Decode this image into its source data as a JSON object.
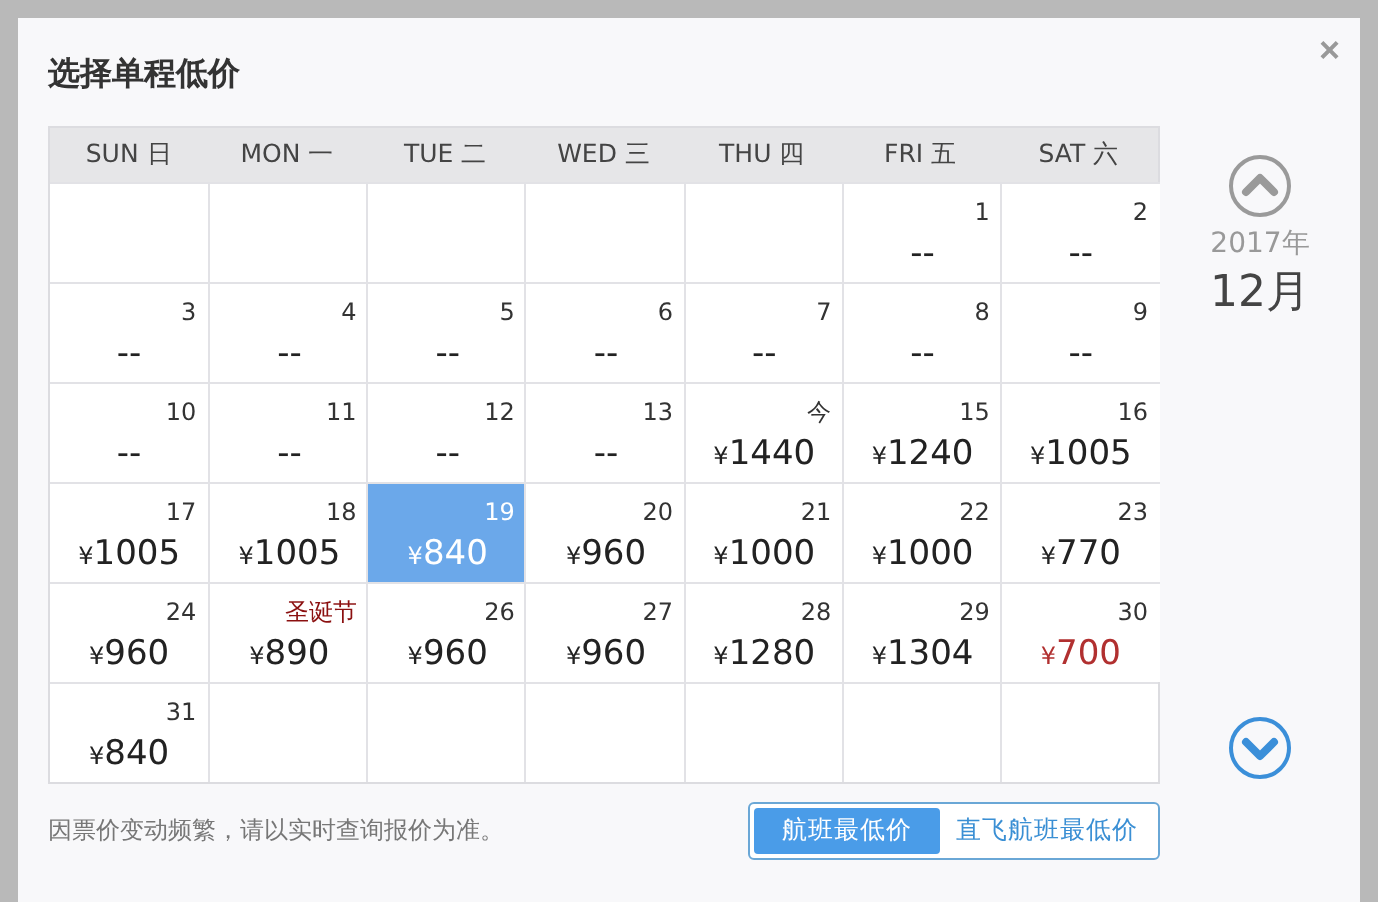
{
  "dialog": {
    "title": "选择单程低价",
    "close": "×"
  },
  "weekdays": [
    "SUN 日",
    "MON 一",
    "TUE 二",
    "WED 三",
    "THU 四",
    "FRI 五",
    "SAT 六"
  ],
  "weeks": [
    [
      {
        "kind": "blank"
      },
      {
        "kind": "blank"
      },
      {
        "kind": "blank"
      },
      {
        "kind": "blank"
      },
      {
        "kind": "blank"
      },
      {
        "kind": "day",
        "day": "1",
        "price": "--",
        "holiday": false,
        "selected": false,
        "lowest": false
      },
      {
        "kind": "day",
        "day": "2",
        "price": "--",
        "holiday": false,
        "selected": false,
        "lowest": false
      }
    ],
    [
      {
        "kind": "day",
        "day": "3",
        "price": "--",
        "holiday": false,
        "selected": false,
        "lowest": false
      },
      {
        "kind": "day",
        "day": "4",
        "price": "--",
        "holiday": false,
        "selected": false,
        "lowest": false
      },
      {
        "kind": "day",
        "day": "5",
        "price": "--",
        "holiday": false,
        "selected": false,
        "lowest": false
      },
      {
        "kind": "day",
        "day": "6",
        "price": "--",
        "holiday": false,
        "selected": false,
        "lowest": false
      },
      {
        "kind": "day",
        "day": "7",
        "price": "--",
        "holiday": false,
        "selected": false,
        "lowest": false
      },
      {
        "kind": "day",
        "day": "8",
        "price": "--",
        "holiday": false,
        "selected": false,
        "lowest": false
      },
      {
        "kind": "day",
        "day": "9",
        "price": "--",
        "holiday": false,
        "selected": false,
        "lowest": false
      }
    ],
    [
      {
        "kind": "day",
        "day": "10",
        "price": "--",
        "holiday": false,
        "selected": false,
        "lowest": false
      },
      {
        "kind": "day",
        "day": "11",
        "price": "--",
        "holiday": false,
        "selected": false,
        "lowest": false
      },
      {
        "kind": "day",
        "day": "12",
        "price": "--",
        "holiday": false,
        "selected": false,
        "lowest": false
      },
      {
        "kind": "day",
        "day": "13",
        "price": "--",
        "holiday": false,
        "selected": false,
        "lowest": false
      },
      {
        "kind": "day",
        "day": "今",
        "currency": "¥",
        "price": "1440",
        "holiday": false,
        "selected": false,
        "lowest": false
      },
      {
        "kind": "day",
        "day": "15",
        "currency": "¥",
        "price": "1240",
        "holiday": false,
        "selected": false,
        "lowest": false
      },
      {
        "kind": "day",
        "day": "16",
        "currency": "¥",
        "price": "1005",
        "holiday": false,
        "selected": false,
        "lowest": false
      }
    ],
    [
      {
        "kind": "day",
        "day": "17",
        "currency": "¥",
        "price": "1005",
        "holiday": false,
        "selected": false,
        "lowest": false
      },
      {
        "kind": "day",
        "day": "18",
        "currency": "¥",
        "price": "1005",
        "holiday": false,
        "selected": false,
        "lowest": false
      },
      {
        "kind": "day",
        "day": "19",
        "currency": "¥",
        "price": "840",
        "holiday": false,
        "selected": true,
        "lowest": false
      },
      {
        "kind": "day",
        "day": "20",
        "currency": "¥",
        "price": "960",
        "holiday": false,
        "selected": false,
        "lowest": false
      },
      {
        "kind": "day",
        "day": "21",
        "currency": "¥",
        "price": "1000",
        "holiday": false,
        "selected": false,
        "lowest": false
      },
      {
        "kind": "day",
        "day": "22",
        "currency": "¥",
        "price": "1000",
        "holiday": false,
        "selected": false,
        "lowest": false
      },
      {
        "kind": "day",
        "day": "23",
        "currency": "¥",
        "price": "770",
        "holiday": false,
        "selected": false,
        "lowest": false
      }
    ],
    [
      {
        "kind": "day",
        "day": "24",
        "currency": "¥",
        "price": "960",
        "holiday": false,
        "selected": false,
        "lowest": false
      },
      {
        "kind": "day",
        "day": "圣诞节",
        "currency": "¥",
        "price": "890",
        "holiday": true,
        "selected": false,
        "lowest": false
      },
      {
        "kind": "day",
        "day": "26",
        "currency": "¥",
        "price": "960",
        "holiday": false,
        "selected": false,
        "lowest": false
      },
      {
        "kind": "day",
        "day": "27",
        "currency": "¥",
        "price": "960",
        "holiday": false,
        "selected": false,
        "lowest": false
      },
      {
        "kind": "day",
        "day": "28",
        "currency": "¥",
        "price": "1280",
        "holiday": false,
        "selected": false,
        "lowest": false
      },
      {
        "kind": "day",
        "day": "29",
        "currency": "¥",
        "price": "1304",
        "holiday": false,
        "selected": false,
        "lowest": false
      },
      {
        "kind": "day",
        "day": "30",
        "currency": "¥",
        "price": "700",
        "holiday": false,
        "selected": false,
        "lowest": true
      }
    ],
    [
      {
        "kind": "day",
        "day": "31",
        "currency": "¥",
        "price": "840",
        "holiday": false,
        "selected": false,
        "lowest": false
      },
      {
        "kind": "blank"
      },
      {
        "kind": "blank"
      },
      {
        "kind": "blank"
      },
      {
        "kind": "blank"
      },
      {
        "kind": "blank"
      },
      {
        "kind": "blank"
      }
    ]
  ],
  "month_nav": {
    "prev": {
      "disabled": true
    },
    "year": "2017年",
    "month": "12月",
    "next": {
      "disabled": false
    }
  },
  "footer": {
    "note": "因票价变动频繁，请以实时查询报价为准。",
    "toggle": [
      {
        "label": "航班最低价",
        "selected": true
      },
      {
        "label": "直飞航班最低价",
        "selected": false
      }
    ]
  }
}
